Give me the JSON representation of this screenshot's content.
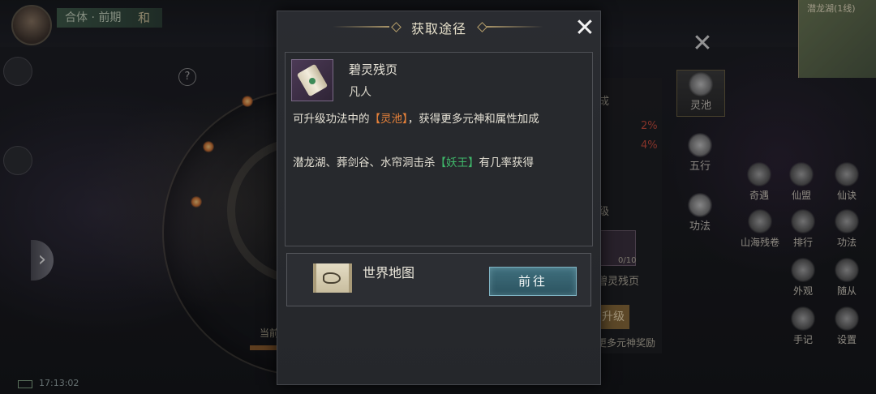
{
  "background": {
    "realm_label": "合体 · 前期",
    "realm_char": "和",
    "clock": "17:13:02",
    "help_icon": "?",
    "side_arrow": "›",
    "minimap_label": "潜龙湖(1线)",
    "bottom_hint": "当前",
    "right_panel": {
      "label_1": "成",
      "pct_1": "2%",
      "pct_2": "4%",
      "label_2": "级",
      "slot_count": "0/10",
      "slot_name": "碧灵残页",
      "upgrade_label": "升级",
      "reward_hint": "更多元神奖励"
    },
    "tabs": [
      {
        "label": "灵池",
        "active": true
      },
      {
        "label": "五行",
        "active": false
      },
      {
        "label": "功法",
        "active": false
      }
    ],
    "functions": [
      {
        "label": "奇遇"
      },
      {
        "label": "仙盟"
      },
      {
        "label": "仙诀"
      },
      {
        "label": "山海残卷"
      },
      {
        "label": "排行"
      },
      {
        "label": "功法"
      },
      {
        "label": "外观"
      },
      {
        "label": "随从"
      },
      {
        "label": "手记"
      },
      {
        "label": "设置"
      }
    ]
  },
  "dialog": {
    "title": "获取途径",
    "close_icon": "✕",
    "item": {
      "name": "碧灵残页",
      "grade": "凡人",
      "icon": "scroll-icon",
      "desc_prefix": "可升级功法中的",
      "desc_highlight": "【灵池】",
      "desc_suffix": "，获得更多元神和属性加成",
      "source_prefix": "潜龙湖、葬剑谷、水帘洞击杀",
      "source_highlight": "【妖王】",
      "source_suffix": "有几率获得"
    },
    "way": {
      "label": "世界地图",
      "icon": "world-map-icon",
      "button": "前往"
    }
  },
  "colors": {
    "highlight_orange": "#e8823a",
    "highlight_green": "#3fb86a",
    "button_teal": "#3f6f7d",
    "percent_red": "#c84a3a"
  }
}
